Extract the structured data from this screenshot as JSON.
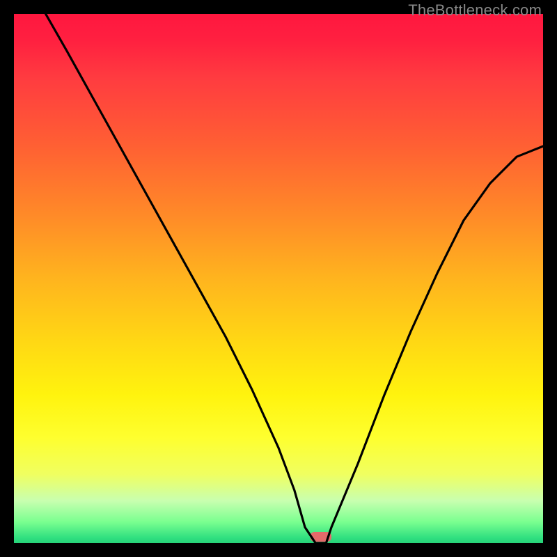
{
  "watermark": "TheBottleneck.com",
  "chart_data": {
    "type": "line",
    "title": "",
    "xlabel": "",
    "ylabel": "",
    "xlim": [
      0,
      100
    ],
    "ylim": [
      0,
      100
    ],
    "grid": false,
    "legend": false,
    "series": [
      {
        "name": "bottleneck-curve",
        "x": [
          6,
          10,
          15,
          20,
          25,
          30,
          35,
          40,
          45,
          50,
          53,
          55,
          57,
          59,
          60,
          65,
          70,
          75,
          80,
          85,
          90,
          95,
          100
        ],
        "values": [
          100,
          93,
          84,
          75,
          66,
          57,
          48,
          39,
          29,
          18,
          10,
          3,
          0,
          0,
          3,
          15,
          28,
          40,
          51,
          61,
          68,
          73,
          75
        ]
      }
    ],
    "marker": {
      "name": "optimal-marker",
      "x_center": 58,
      "width": 4,
      "color": "#e46a6a"
    },
    "background_gradient_stops": [
      {
        "pos": 0.0,
        "color": "#ff173f"
      },
      {
        "pos": 0.25,
        "color": "#ff6033"
      },
      {
        "pos": 0.5,
        "color": "#ffb41e"
      },
      {
        "pos": 0.72,
        "color": "#fff30e"
      },
      {
        "pos": 0.92,
        "color": "#c8ffb0"
      },
      {
        "pos": 1.0,
        "color": "#26d178"
      }
    ]
  }
}
